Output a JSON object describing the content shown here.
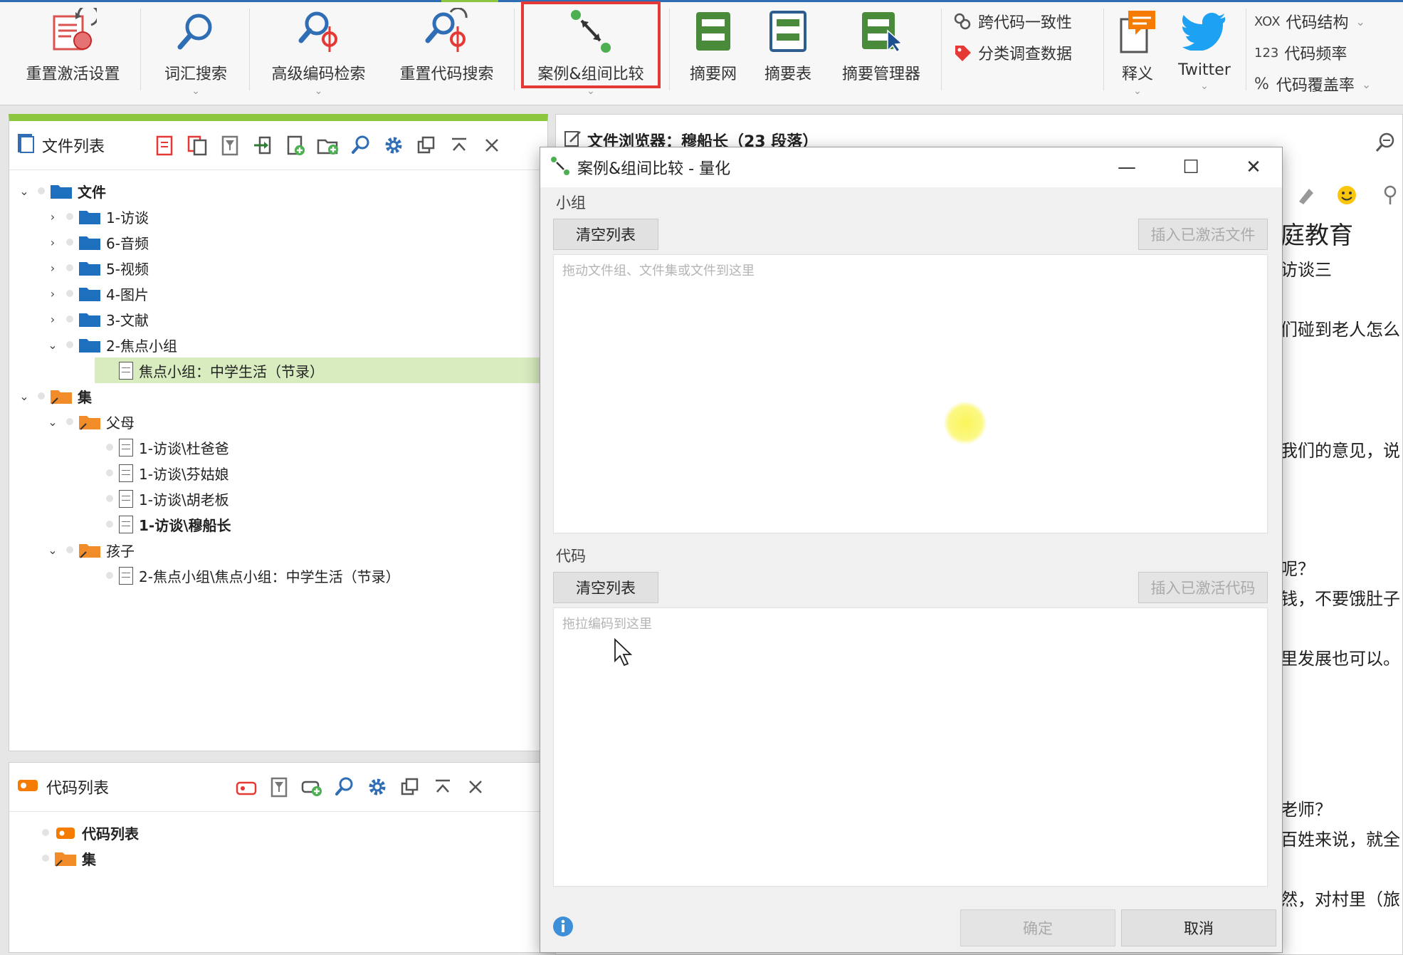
{
  "ribbon": {
    "buttons": [
      {
        "label": "重置激活设置"
      },
      {
        "label": "词汇搜索"
      },
      {
        "label": "高级编码检索"
      },
      {
        "label": "重置代码搜索"
      },
      {
        "label": "案例&组间比较"
      },
      {
        "label": "摘要网"
      },
      {
        "label": "摘要表"
      },
      {
        "label": "摘要管理器"
      },
      {
        "label": "释义"
      },
      {
        "label": "Twitter"
      }
    ],
    "small": {
      "cross_code": "跨代码一致性",
      "survey": "分类调查数据",
      "code_structure": "代码结构",
      "code_frequency": "代码频率",
      "code_coverage": "代码覆盖率",
      "xox_prefix": "XOX",
      "freq_prefix": "123",
      "cov_prefix": "%"
    }
  },
  "file_list": {
    "title": "文件列表",
    "rows": [
      {
        "label": "文件"
      },
      {
        "label": "1-访谈"
      },
      {
        "label": "6-音频"
      },
      {
        "label": "5-视频"
      },
      {
        "label": "4-图片"
      },
      {
        "label": "3-文献"
      },
      {
        "label": "2-焦点小组"
      },
      {
        "label": "焦点小组：中学生活（节录）"
      },
      {
        "label": "集"
      },
      {
        "label": "父母"
      },
      {
        "label": "1-访谈\\杜爸爸"
      },
      {
        "label": "1-访谈\\芬姑娘"
      },
      {
        "label": "1-访谈\\胡老板"
      },
      {
        "label": "1-访谈\\穆船长"
      },
      {
        "label": "孩子"
      },
      {
        "label": "2-焦点小组\\焦点小组：中学生活（节录）"
      }
    ]
  },
  "code_list": {
    "title": "代码列表",
    "rows": [
      {
        "label": "代码列表"
      },
      {
        "label": "集"
      }
    ]
  },
  "doc_browser": {
    "title": "文件浏览器：穆船长（23 段落）",
    "lines": [
      "庭教育",
      "访谈三",
      "们碰到老人怎么",
      "我们的意见，说",
      "呢？",
      "钱，不要饿肚子",
      "里发展也可以。",
      "老师？",
      "百姓来说，就全",
      "然，对村里（旅"
    ]
  },
  "dialog": {
    "title": "案例&组间比较 - 量化",
    "group_label": "小组",
    "clear_list_1": "清空列表",
    "insert_active_files": "插入已激活文件",
    "group_placeholder": "拖动文件组、文件集或文件到这里",
    "code_label": "代码",
    "clear_list_2": "清空列表",
    "insert_active_codes": "插入已激活代码",
    "code_placeholder": "拖拉编码到这里",
    "ok": "确定",
    "cancel": "取消",
    "minimize": "—",
    "maximize": "☐",
    "close": "✕"
  },
  "colors": {
    "accent_blue": "#2f6db5",
    "accent_green": "#8cc63f",
    "highlight_red": "#e53935",
    "folder_blue": "#1f6fbf",
    "folder_orange": "#f28c28",
    "selected_row": "#d9ecc0"
  }
}
